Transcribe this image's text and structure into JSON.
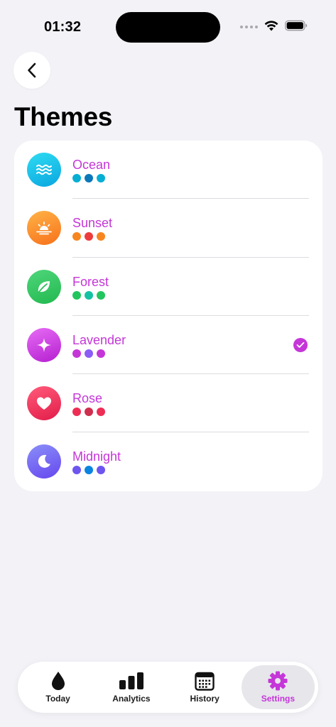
{
  "status_bar": {
    "time": "01:32"
  },
  "header": {
    "back_icon": "chevron-left-icon",
    "title": "Themes"
  },
  "accent_color": "#c536d8",
  "themes": [
    {
      "name": "Ocean",
      "icon": "waves-icon",
      "gradient": [
        "#22d3ee",
        "#0ea5e9"
      ],
      "swatches": [
        "#06aed4",
        "#0b77b8",
        "#06aed4"
      ],
      "selected": false
    },
    {
      "name": "Sunset",
      "icon": "sunrise-icon",
      "gradient": [
        "#fdba3b",
        "#f97316"
      ],
      "swatches": [
        "#f7861f",
        "#ee3b3b",
        "#f7861f"
      ],
      "selected": false
    },
    {
      "name": "Forest",
      "icon": "leaf-icon",
      "gradient": [
        "#4ade80",
        "#22c55e"
      ],
      "swatches": [
        "#22c55e",
        "#13c2a3",
        "#22c55e"
      ],
      "selected": false
    },
    {
      "name": "Lavender",
      "icon": "sparkle-icon",
      "gradient": [
        "#e879f9",
        "#c026d3"
      ],
      "swatches": [
        "#c536d8",
        "#8b5cf6",
        "#c536d8"
      ],
      "selected": true
    },
    {
      "name": "Rose",
      "icon": "heart-icon",
      "gradient": [
        "#fb5a7a",
        "#e11d48"
      ],
      "swatches": [
        "#ee2d55",
        "#cf2e4e",
        "#ee2d55"
      ],
      "selected": false
    },
    {
      "name": "Midnight",
      "icon": "moon-icon",
      "gradient": [
        "#818cf8",
        "#6d4ff2"
      ],
      "swatches": [
        "#6d55f0",
        "#0b84e0",
        "#6d55f0"
      ],
      "selected": false
    }
  ],
  "tab_bar": {
    "tabs": [
      {
        "label": "Today",
        "icon": "drop-icon",
        "active": false
      },
      {
        "label": "Analytics",
        "icon": "bar-chart-icon",
        "active": false
      },
      {
        "label": "History",
        "icon": "calendar-icon",
        "active": false
      },
      {
        "label": "Settings",
        "icon": "gear-icon",
        "active": true
      }
    ]
  }
}
